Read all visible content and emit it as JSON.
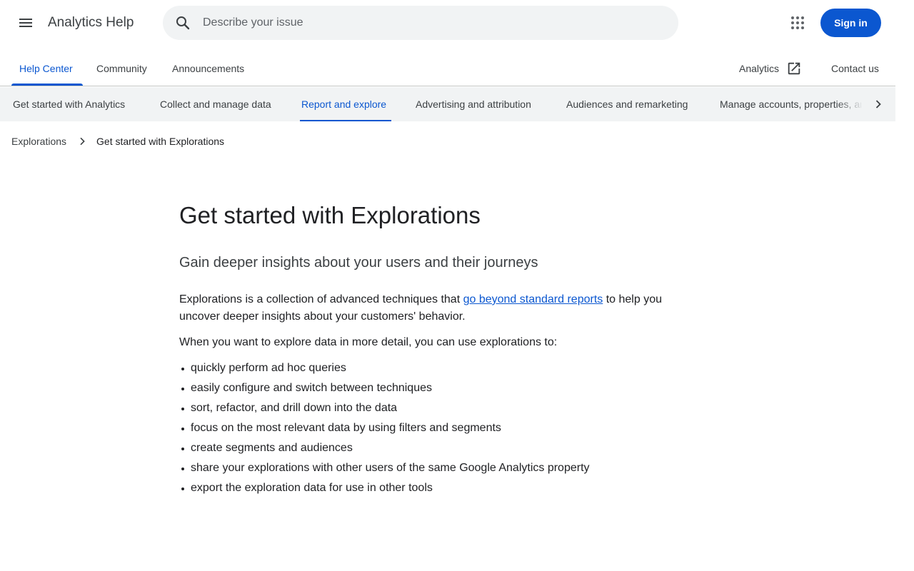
{
  "header": {
    "app_title": "Analytics Help",
    "search_placeholder": "Describe your issue",
    "signin_label": "Sign in",
    "accent_color": "#0b57d0"
  },
  "primary_tabs": {
    "items": [
      {
        "label": "Help Center",
        "active": true
      },
      {
        "label": "Community",
        "active": false
      },
      {
        "label": "Announcements",
        "active": false
      }
    ],
    "external_link": "Analytics",
    "contact": "Contact us"
  },
  "category_nav": {
    "items": [
      {
        "label": "Get started with Analytics",
        "active": false
      },
      {
        "label": "Collect and manage data",
        "active": false
      },
      {
        "label": "Report and explore",
        "active": true
      },
      {
        "label": "Advertising and attribution",
        "active": false
      },
      {
        "label": "Audiences and remarketing",
        "active": false
      },
      {
        "label": "Manage accounts, properties, and users",
        "active": false
      }
    ]
  },
  "breadcrumb": {
    "parent": "Explorations",
    "current": "Get started with Explorations"
  },
  "article": {
    "title": "Get started with Explorations",
    "subtitle": "Gain deeper insights about your users and their journeys",
    "intro_before": "Explorations is a collection of advanced techniques that ",
    "intro_link": "go beyond standard reports",
    "intro_after": " to help you uncover deeper insights about your customers' behavior.",
    "lead": "When you want to explore data in more detail, you can use explorations to:",
    "bullets": [
      "quickly perform ad hoc queries",
      "easily configure and switch between techniques",
      "sort, refactor, and drill down into the data",
      "focus on the most relevant data by using filters and segments",
      "create segments and audiences",
      "share your explorations with other users of the same Google Analytics property",
      "export the exploration data for use in other tools"
    ]
  },
  "icons": {
    "menu": "menu-icon",
    "search": "search-icon",
    "apps": "apps-grid-icon",
    "open_in_new": "open-in-new-icon",
    "chevron_right": "chevron-right-icon"
  }
}
